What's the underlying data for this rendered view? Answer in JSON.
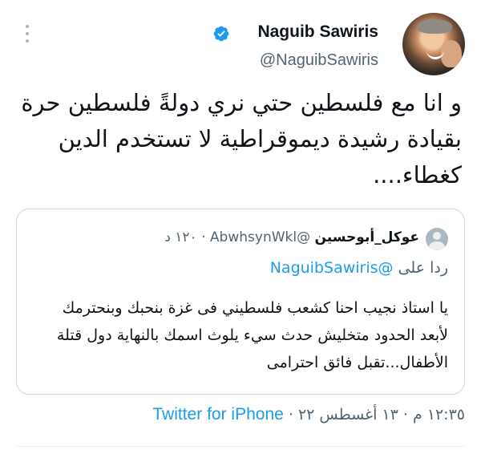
{
  "tweet": {
    "author": {
      "name": "Naguib Sawiris",
      "handle": "@NaguibSawiris",
      "verified": true
    },
    "text": "و انا مع فلسطين حتي نري دولةً فلسطين حرة بقيادة رشيدة ديموقراطية لا تستخدم الدين كغطاء....",
    "timestamp": "١٢:٣٥ م · ١٣ أغسطس ٢٢",
    "source": "Twitter for iPhone",
    "separator": "·"
  },
  "quoted": {
    "name": "عوكل_أبوحسين",
    "handle": "@AbwhsynWkl",
    "time": "١٢٠ د",
    "dot": "·",
    "reply_prefix": "ردا على",
    "reply_to": "@NaguibSawiris",
    "text": "يا استاذ نجيب احنا كشعب فلسطيني فى غزة بنحبك وبنحترمك لأبعد الحدود متخليش حدث سيء يلوث اسمك بالنهاية دول قتلة الأطفال...تقبل فائق احترامى"
  },
  "colors": {
    "accent": "#1d9bf0",
    "secondary_text": "#536471",
    "border": "#cfd9de"
  },
  "icons": [
    "more-options-icon",
    "verified-badge-icon",
    "default-avatar-icon"
  ]
}
